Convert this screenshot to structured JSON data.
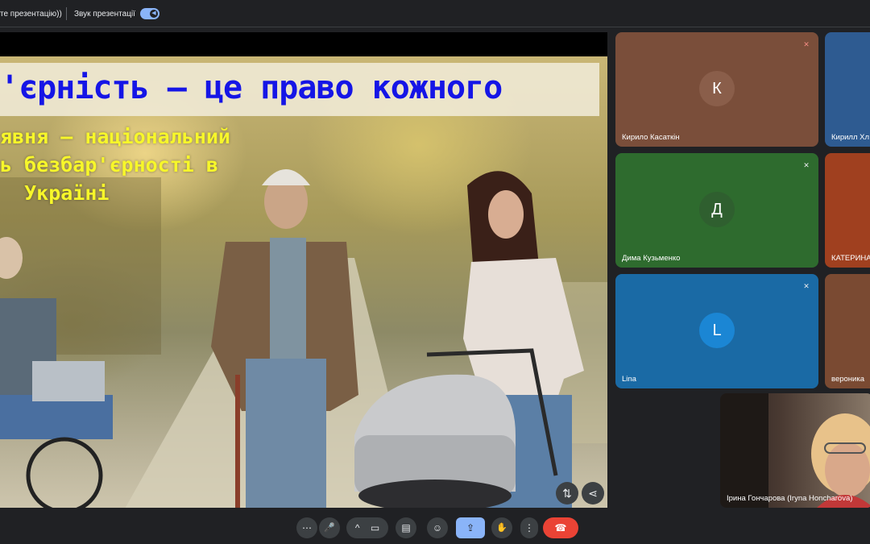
{
  "topbar": {
    "presentation_text": "те презентацію))",
    "sound_label": "Звук презентації",
    "sound_toggle_on": true
  },
  "slide": {
    "title": "'єрність — це право кожного",
    "subtitle_lines": [
      "явня – національний",
      "ь безбар'єрності в",
      "  Україні"
    ]
  },
  "participants": [
    {
      "name": "Кирило Касаткін",
      "initial": "К",
      "color": "#7a4e3a",
      "avatar_color": "#8a5e4a",
      "muted": true
    },
    {
      "name": "Кирилл Хл",
      "initial": "",
      "color": "#2e5b91",
      "avatar_color": "",
      "muted": false
    },
    {
      "name": "Дима Кузьменко",
      "initial": "Д",
      "color": "#2e6b2e",
      "avatar_color": "#2f5f2f",
      "muted": true
    },
    {
      "name": "КАТЕРИНА",
      "initial": "",
      "color": "#a0401f",
      "avatar_color": "",
      "muted": false
    },
    {
      "name": "Lina",
      "initial": "L",
      "color": "#1a6aa5",
      "avatar_color": "#1b86d4",
      "muted": true
    },
    {
      "name": "вероника",
      "initial": "",
      "color": "#7a4a32",
      "avatar_color": "",
      "muted": false
    },
    {
      "name": "Ірина Гончарова (Iryna Honcharova)",
      "initial": "",
      "color": "#3a2e2a",
      "avatar_color": "",
      "muted": false
    }
  ],
  "icons": {
    "more": "⋯",
    "mic": "🎤",
    "chevron": "^",
    "camera": "▭",
    "captions": "▤",
    "emoji": "☺",
    "present": "⇪",
    "hand": "✋",
    "menu": "⋮",
    "hangup": "☎",
    "pin": "⇅",
    "share": "⋖",
    "muted": "🔇"
  },
  "colors": {
    "bg": "#202124",
    "accent": "#8ab4f8",
    "hangup": "#ea4335",
    "title_text": "#1515e6",
    "subtitle_text": "#f7f72a"
  }
}
